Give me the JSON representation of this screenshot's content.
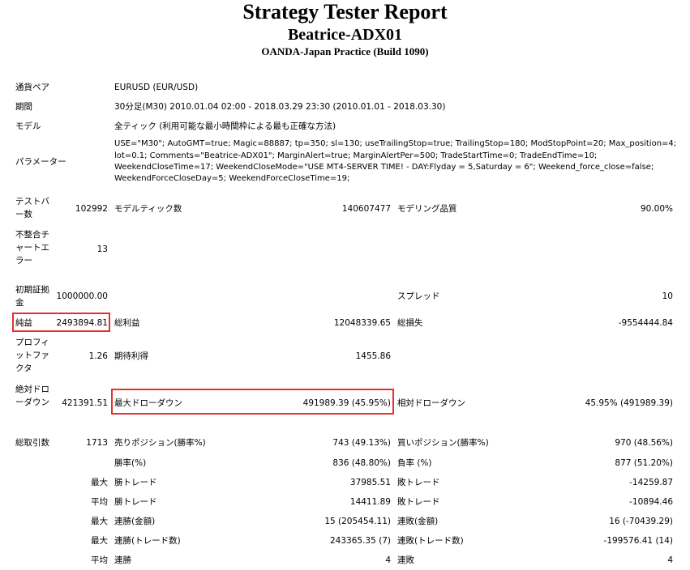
{
  "header": {
    "title": "Strategy Tester Report",
    "subtitle": "Beatrice-ADX01",
    "broker": "OANDA-Japan Practice (Build 1090)"
  },
  "info": {
    "symbol_label": "通貨ペア",
    "symbol_value": "EURUSD (EUR/USD)",
    "period_label": "期間",
    "period_value": "30分足(M30) 2010.01.04 02:00 - 2018.03.29 23:30 (2010.01.01 - 2018.03.30)",
    "model_label": "モデル",
    "model_value": "全ティック (利用可能な最小時間枠による最も正確な方法)",
    "params_label": "パラメーター",
    "params_line1": "USE=\"M30\"; AutoGMT=true; Magic=88887; tp=350; sl=130; useTrailingStop=true; TrailingStop=180; ModStopPoint=20; Max_position=4;",
    "params_line2": "lot=0.1; Comments=\"Beatrice-ADX01\"; MarginAlert=true; MarginAlertPer=500; TradeStartTime=0; TradeEndTime=10;",
    "params_line3": "WeekendCloseTime=17; WeekendCloseMode=\"USE MT4-SERVER TIME! - DAY:Flyday = 5,Saturday = 6\"; Weekend_force_close=false;",
    "params_line4": "WeekendForceCloseDay=5; WeekendForceCloseTime=19;"
  },
  "stats": {
    "bars_label": "テストバー数",
    "bars_value": "102992",
    "ticks_label": "モデルティック数",
    "ticks_value": "140607477",
    "quality_label": "モデリング品質",
    "quality_value": "90.00%",
    "mismatch_label": "不整合チャートエラー",
    "mismatch_value": "13",
    "deposit_label": "初期証拠金",
    "deposit_value": "1000000.00",
    "spread_label": "スプレッド",
    "spread_value": "10",
    "net_label": "純益",
    "net_value": "2493894.81",
    "gross_profit_label": "総利益",
    "gross_profit_value": "12048339.65",
    "gross_loss_label": "総損失",
    "gross_loss_value": "-9554444.84",
    "pf_label": "プロフィットファクタ",
    "pf_value": "1.26",
    "payoff_label": "期待利得",
    "payoff_value": "1455.86",
    "abs_dd_label": "絶対ドローダウン",
    "abs_dd_value": "421391.51",
    "max_dd_label": "最大ドローダウン",
    "max_dd_value": "491989.39 (45.95%)",
    "rel_dd_label": "相対ドローダウン",
    "rel_dd_value": "45.95% (491989.39)"
  },
  "trades": {
    "total_label": "総取引数",
    "total_value": "1713",
    "short_label": "売りポジション(勝率%)",
    "short_value": "743 (49.13%)",
    "long_label": "買いポジション(勝率%)",
    "long_value": "970 (48.56%)",
    "win_rate_label": "勝率(%)",
    "win_rate_value": "836 (48.80%)",
    "loss_rate_label": "負率 (%)",
    "loss_rate_value": "877 (51.20%)",
    "r1_prefix": "最大",
    "r1_win_label": "勝トレード",
    "r1_win_value": "37985.51",
    "r1_loss_label": "敗トレード",
    "r1_loss_value": "-14259.87",
    "r2_prefix": "平均",
    "r2_win_label": "勝トレード",
    "r2_win_value": "14411.89",
    "r2_loss_label": "敗トレード",
    "r2_loss_value": "-10894.46",
    "r3_prefix": "最大",
    "r3_win_label": "連勝(金額)",
    "r3_win_value": "15 (205454.11)",
    "r3_loss_label": "連敗(金額)",
    "r3_loss_value": "16 (-70439.29)",
    "r4_prefix": "最大",
    "r4_win_label": "連勝(トレード数)",
    "r4_win_value": "243365.35 (7)",
    "r4_loss_label": "連敗(トレード数)",
    "r4_loss_value": "-199576.41 (14)",
    "r5_prefix": "平均",
    "r5_win_label": "連勝",
    "r5_win_value": "4",
    "r5_loss_label": "連敗",
    "r5_loss_value": "4"
  },
  "highlight_color": "#e4312b"
}
